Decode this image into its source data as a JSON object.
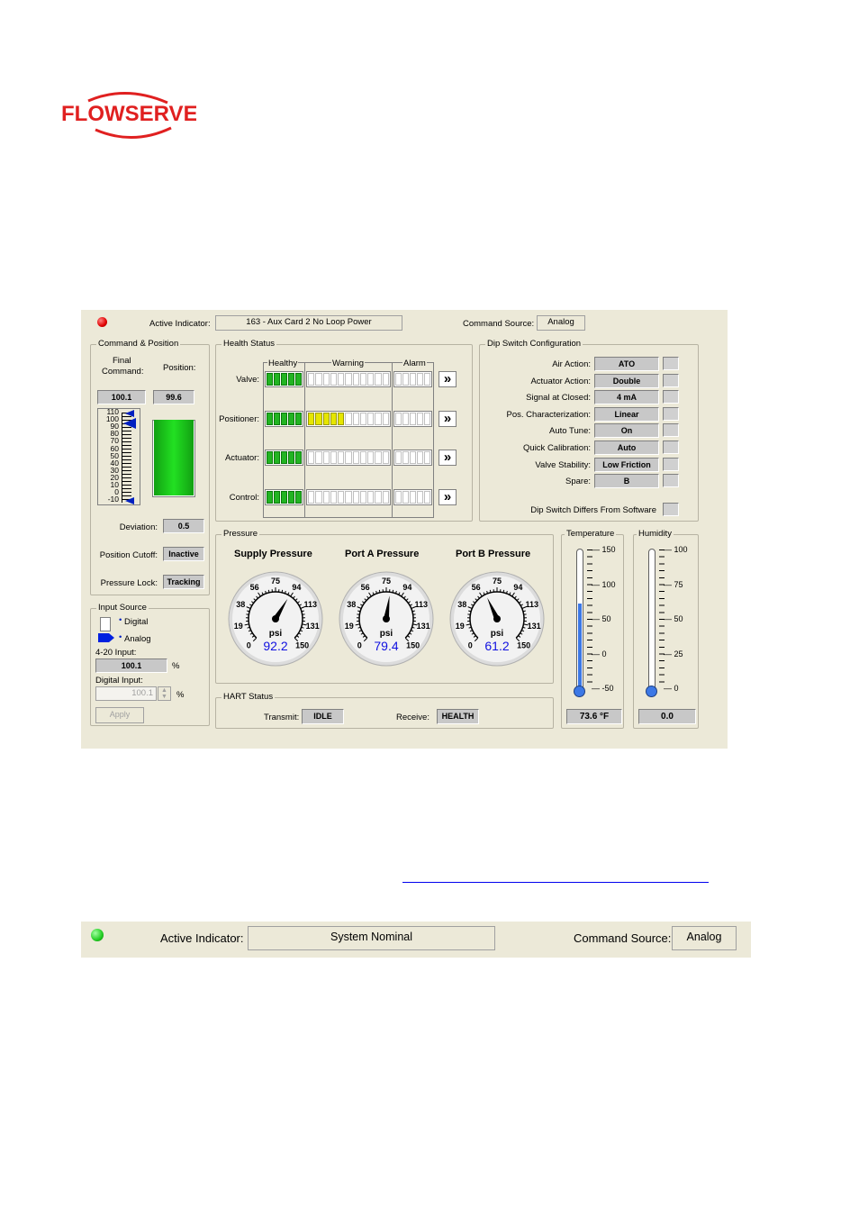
{
  "brand": {
    "name": "FLOWSERVE",
    "color": "#e02020"
  },
  "main": {
    "active_indicator_label": "Active Indicator:",
    "active_indicator_value": "163 - Aux Card 2 No Loop Power",
    "active_indicator_led_color": "#e00000",
    "command_source_label": "Command Source:",
    "command_source_value": "Analog"
  },
  "command_position": {
    "title": "Command & Position",
    "final_command_label_1": "Final",
    "final_command_label_2": "Command:",
    "position_label": "Position:",
    "final_command_value": "100.1",
    "position_value": "99.6",
    "scale_ticks": [
      "110",
      "100",
      "90",
      "80",
      "70",
      "60",
      "50",
      "40",
      "30",
      "20",
      "10",
      "0",
      "-10"
    ],
    "position_percent": 99.6,
    "deviation_label": "Deviation:",
    "deviation_value": "0.5",
    "position_cutoff_label": "Position Cutoff:",
    "position_cutoff_value": "Inactive",
    "pressure_lock_label": "Pressure Lock:",
    "pressure_lock_value": "Tracking"
  },
  "input_source": {
    "title": "Input Source",
    "digital_label": "Digital",
    "analog_label": "Analog",
    "input_420_label": "4-20 Input:",
    "input_420_value": "100.1",
    "percent_unit": "%",
    "digital_input_label": "Digital Input:",
    "digital_input_value": "100.1",
    "apply_label": "Apply"
  },
  "health_status": {
    "title": "Health Status",
    "col_healthy": "Healthy",
    "col_warning": "Warning",
    "col_alarm": "Alarm",
    "rows": [
      {
        "label": "Valve:",
        "warning_level": 0
      },
      {
        "label": "Positioner:",
        "warning_level": 5
      },
      {
        "label": "Actuator:",
        "warning_level": 0
      },
      {
        "label": "Control:",
        "warning_level": 0
      }
    ],
    "arrow_glyph": "»"
  },
  "dip_switch": {
    "title": "Dip Switch Configuration",
    "rows": [
      {
        "label": "Air Action:",
        "value": "ATO"
      },
      {
        "label": "Actuator Action:",
        "value": "Double"
      },
      {
        "label": "Signal at Closed:",
        "value": "4 mA"
      },
      {
        "label": "Pos. Characterization:",
        "value": "Linear"
      },
      {
        "label": "Auto Tune:",
        "value": "On"
      },
      {
        "label": "Quick Calibration:",
        "value": "Auto"
      },
      {
        "label": "Valve Stability:",
        "value": "Low Friction"
      },
      {
        "label": "Spare:",
        "value": "B"
      }
    ],
    "differs_label": "Dip Switch Differs From Software"
  },
  "pressure": {
    "title": "Pressure",
    "unit": "psi",
    "gauges": [
      {
        "title": "Supply Pressure",
        "value": "92.2"
      },
      {
        "title": "Port A Pressure",
        "value": "79.4"
      },
      {
        "title": "Port B Pressure",
        "value": "61.2"
      }
    ],
    "ticks": [
      "0",
      "19",
      "38",
      "56",
      "75",
      "94",
      "113",
      "131",
      "150"
    ]
  },
  "temperature": {
    "title": "Temperature",
    "ticks": [
      "150",
      "100",
      "50",
      "0",
      "-50"
    ],
    "value": "73.6 °F",
    "fill_color": "#3c78e6"
  },
  "humidity": {
    "title": "Humidity",
    "ticks": [
      "100",
      "75",
      "50",
      "25",
      "0"
    ],
    "value": "0.0"
  },
  "hart": {
    "title": "HART Status",
    "transmit_label": "Transmit:",
    "transmit_value": "IDLE",
    "receive_label": "Receive:",
    "receive_value": "HEALTH"
  },
  "bottom_bar": {
    "active_indicator_label": "Active Indicator:",
    "active_indicator_value": "System Nominal",
    "led_color": "#22cc22",
    "command_source_label": "Command Source:",
    "command_source_value": "Analog"
  }
}
